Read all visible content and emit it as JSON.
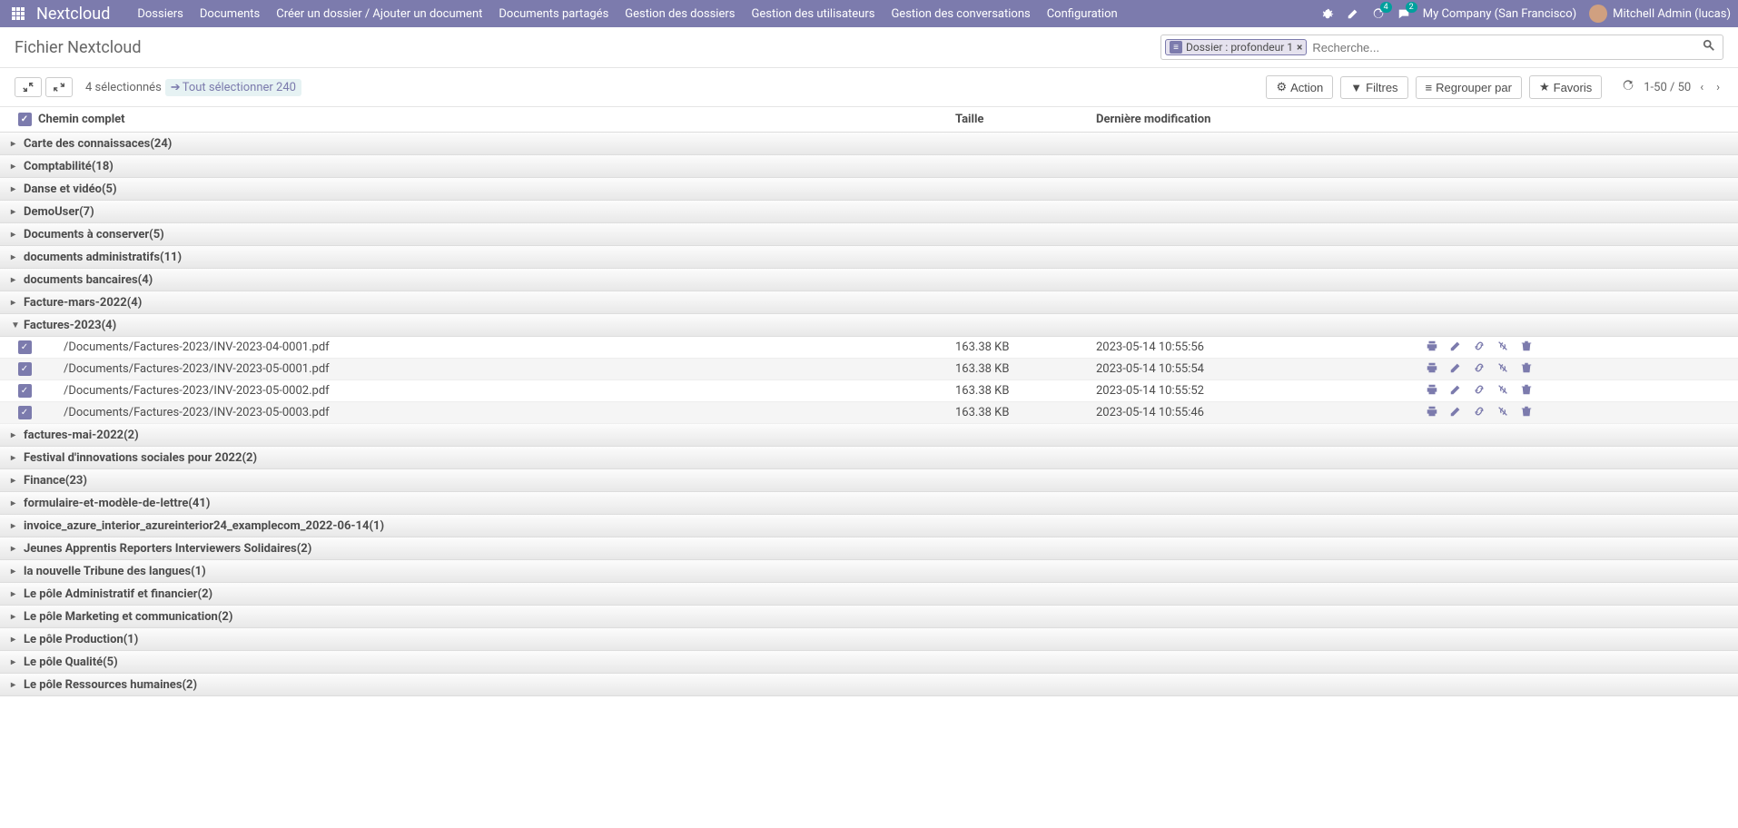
{
  "navbar": {
    "brand": "Nextcloud",
    "menu": [
      "Dossiers",
      "Documents",
      "Créer un dossier / Ajouter un document",
      "Documents partagés",
      "Gestion des dossiers",
      "Gestion des utilisateurs",
      "Gestion des conversations",
      "Configuration"
    ],
    "badge_refresh": "4",
    "badge_chat": "2",
    "company": "My Company (San Francisco)",
    "user": "Mitchell Admin (lucas)"
  },
  "header": {
    "title": "Fichier Nextcloud",
    "search_tag": "Dossier : profondeur 1",
    "search_placeholder": "Recherche..."
  },
  "controls": {
    "selected_text": "4 sélectionnés",
    "select_all": "Tout sélectionner 240",
    "action": "Action",
    "filters": "Filtres",
    "group_by": "Regrouper par",
    "favorites": "Favoris",
    "pager": "1-50 / 50"
  },
  "table": {
    "headers": {
      "path": "Chemin complet",
      "size": "Taille",
      "modified": "Dernière modification"
    }
  },
  "groups_before": [
    {
      "label": "Carte des connaissaces",
      "count": "(24)"
    },
    {
      "label": "Comptabilité",
      "count": "(18)"
    },
    {
      "label": "Danse et vidéo",
      "count": "(5)"
    },
    {
      "label": "DemoUser",
      "count": "(7)"
    },
    {
      "label": "Documents à conserver",
      "count": "(5)"
    },
    {
      "label": "documents administratifs",
      "count": "(11)"
    },
    {
      "label": "documents bancaires",
      "count": "(4)"
    },
    {
      "label": "Facture-mars-2022",
      "count": "(4)"
    }
  ],
  "expanded_group": {
    "label": "Factures-2023",
    "count": "(4)"
  },
  "files": [
    {
      "path": "/Documents/Factures-2023/INV-2023-04-0001.pdf",
      "size": "163.38 KB",
      "date": "2023-05-14 10:55:56"
    },
    {
      "path": "/Documents/Factures-2023/INV-2023-05-0001.pdf",
      "size": "163.38 KB",
      "date": "2023-05-14 10:55:54"
    },
    {
      "path": "/Documents/Factures-2023/INV-2023-05-0002.pdf",
      "size": "163.38 KB",
      "date": "2023-05-14 10:55:52"
    },
    {
      "path": "/Documents/Factures-2023/INV-2023-05-0003.pdf",
      "size": "163.38 KB",
      "date": "2023-05-14 10:55:46"
    }
  ],
  "groups_after": [
    {
      "label": "factures-mai-2022",
      "count": "(2)"
    },
    {
      "label": "Festival d'innovations sociales pour 2022",
      "count": "(2)"
    },
    {
      "label": "Finance",
      "count": "(23)"
    },
    {
      "label": "formulaire-et-modèle-de-lettre",
      "count": "(41)"
    },
    {
      "label": "invoice_azure_interior_azureinterior24_examplecom_2022-06-14",
      "count": "(1)"
    },
    {
      "label": "Jeunes Apprentis Reporters Interviewers Solidaires",
      "count": "(2)"
    },
    {
      "label": "la nouvelle Tribune des langues",
      "count": "(1)"
    },
    {
      "label": "Le pôle Administratif et financier",
      "count": "(2)"
    },
    {
      "label": "Le pôle Marketing et communication",
      "count": "(2)"
    },
    {
      "label": "Le pôle Production",
      "count": "(1)"
    },
    {
      "label": "Le pôle Qualité",
      "count": "(5)"
    },
    {
      "label": "Le pôle Ressources humaines",
      "count": "(2)"
    }
  ]
}
